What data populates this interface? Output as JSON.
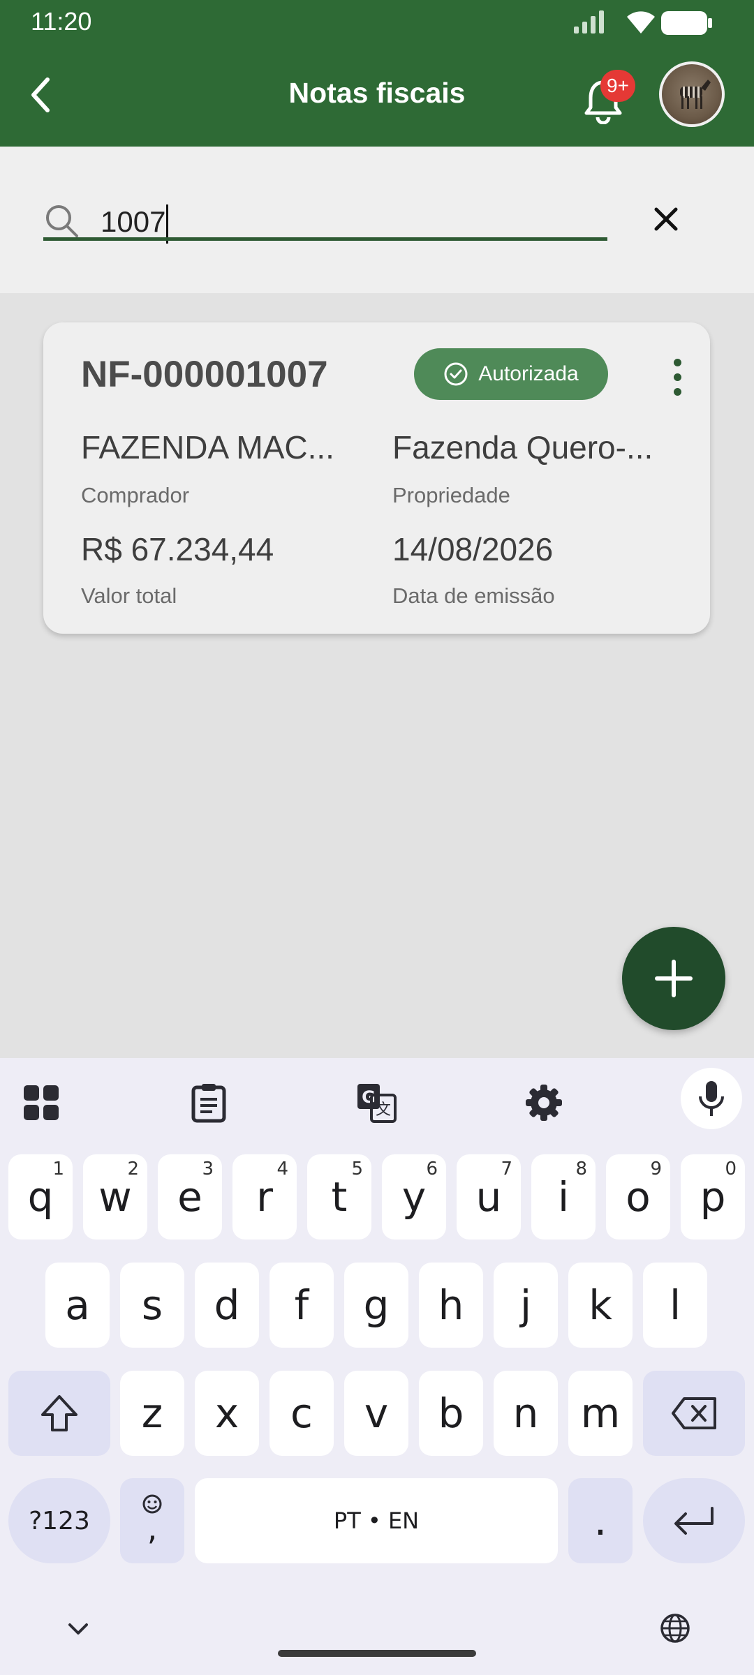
{
  "status_bar": {
    "time": "11:20"
  },
  "header": {
    "title": "Notas fiscais",
    "notification_count": "9+"
  },
  "search": {
    "value": "1007"
  },
  "invoices": [
    {
      "number": "NF-000001007",
      "status": "Autorizada",
      "buyer": "FAZENDA MAC...",
      "buyer_label": "Comprador",
      "property": "Fazenda Quero-...",
      "property_label": "Propriedade",
      "total": "R$ 67.234,44",
      "total_label": "Valor total",
      "issue_date": "14/08/2026",
      "issue_date_label": "Data de emissão"
    }
  ],
  "colors": {
    "header_green": "#2e6a35",
    "status_badge": "#4f8a58",
    "fab": "#214b2b",
    "notification_badge": "#e53935"
  },
  "keyboard": {
    "row1": [
      {
        "key": "q",
        "hint": "1"
      },
      {
        "key": "w",
        "hint": "2"
      },
      {
        "key": "e",
        "hint": "3"
      },
      {
        "key": "r",
        "hint": "4"
      },
      {
        "key": "t",
        "hint": "5"
      },
      {
        "key": "y",
        "hint": "6"
      },
      {
        "key": "u",
        "hint": "7"
      },
      {
        "key": "i",
        "hint": "8"
      },
      {
        "key": "o",
        "hint": "9"
      },
      {
        "key": "p",
        "hint": "0"
      }
    ],
    "row2": [
      "a",
      "s",
      "d",
      "f",
      "g",
      "h",
      "j",
      "k",
      "l"
    ],
    "row3": [
      "z",
      "x",
      "c",
      "v",
      "b",
      "n",
      "m"
    ],
    "symbols_label": "?123",
    "emoji_comma": ",",
    "space_label": "PT • EN",
    "period": ".",
    "icons": {
      "tools": [
        "apps-grid-icon",
        "clipboard-icon",
        "translate-icon",
        "settings-gear-icon",
        "microphone-icon"
      ],
      "shift": "shift-icon",
      "backspace": "backspace-icon",
      "enter": "enter-icon",
      "hide": "chevron-down-icon",
      "language": "globe-icon"
    }
  }
}
